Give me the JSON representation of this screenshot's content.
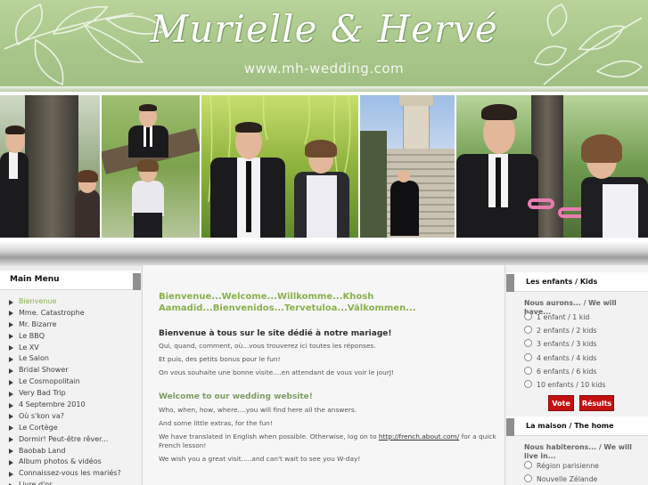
{
  "header": {
    "title": "Murielle & Hervé",
    "url": "www.mh-wedding.com"
  },
  "banner": {
    "photos": [
      "couple-by-tree",
      "couple-on-branch",
      "couple-under-willow",
      "couple-on-steps",
      "couple-handcuffed"
    ]
  },
  "main_menu": {
    "title": "Main Menu",
    "items": [
      {
        "label": "Bienvenue",
        "active": true
      },
      {
        "label": "Mme. Catastrophe"
      },
      {
        "label": "Mr. Bizarre"
      },
      {
        "label": "Le BBQ"
      },
      {
        "label": "Le XV"
      },
      {
        "label": "Le Salon"
      },
      {
        "label": "Bridal Shower"
      },
      {
        "label": "Le Cosmopolitain"
      },
      {
        "label": "Very Bad Trip"
      },
      {
        "label": "4 Septembre 2010"
      },
      {
        "label": "Où s'kon va?"
      },
      {
        "label": "Le Cortège"
      },
      {
        "label": "Dormir! Peut-être rêver..."
      },
      {
        "label": "Baobab Land"
      },
      {
        "label": "Album photos & vidéos"
      },
      {
        "label": "Connaissez-vous les mariés?"
      },
      {
        "label": "Livre d'or"
      }
    ]
  },
  "main": {
    "welcome": "Bienvenue...Welcome...Willkomme...Khosh Aamadid...Bienvenidos...Tervetuloa...Välkommen...",
    "fr_title": "Bienvenue à tous sur le site dédié à notre mariage!",
    "fr_lines": [
      "Qui, quand, comment, où...vous trouverez ici toutes les réponses.",
      "Et puis, des petits bonus pour le fun!",
      "On vous souhaite une bonne visite....en attendant de vous voir le jourJ!"
    ],
    "en_title": "Welcome to our wedding website!",
    "en_lines": [
      "Who, when, how, where....you will find here all the answers.",
      "And some little extras, for the fun!"
    ],
    "en_translate_before": "We have translated in English when possible. Otherwise, log on to ",
    "en_translate_link": "http://french.about.com/",
    "en_translate_after": " for a quick French lesson!",
    "en_last": "We wish you a great visit.....and can't wait to see you W-day!"
  },
  "kids_poll": {
    "title": "Les enfants / Kids",
    "question": "Nous aurons... / We will have...",
    "options": [
      "1 enfant / 1 kid",
      "2 enfants / 2 kids",
      "3 enfants / 3 kids",
      "4 enfants / 4 kids",
      "6 enfants / 6 kids",
      "10 enfants / 10 kids"
    ],
    "vote_label": "Vote",
    "results_label": "Résults"
  },
  "home_poll": {
    "title": "La maison / The home",
    "question": "Nous habiterons... / We will live in...",
    "options": [
      "Région parisienne",
      "Nouvelle Zélande"
    ]
  },
  "colors": {
    "header_green": "#a8c68a",
    "accent_green": "#8ab04d",
    "button_red": "#c41111"
  }
}
